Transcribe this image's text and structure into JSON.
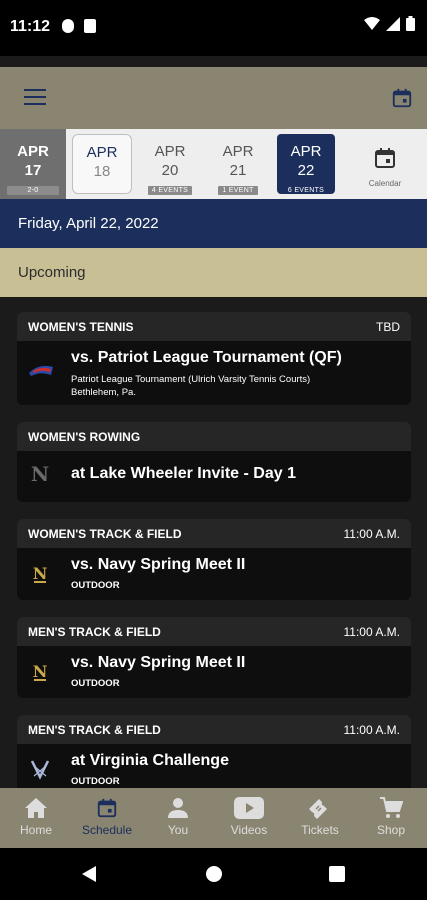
{
  "status_bar": {
    "time": "11:12"
  },
  "dates": [
    {
      "month": "APR",
      "day": "17",
      "badge": "2-0"
    },
    {
      "month": "APR",
      "day": "18",
      "badge": ""
    },
    {
      "month": "APR",
      "day": "20",
      "badge": "4 EVENTS"
    },
    {
      "month": "APR",
      "day": "21",
      "badge": "1 EVENT"
    },
    {
      "month": "APR",
      "day": "22",
      "badge": "6 EVENTS"
    }
  ],
  "calendar_label": "Calendar",
  "date_header": "Friday, April 22, 2022",
  "section_label": "Upcoming",
  "events": [
    {
      "sport": "WOMEN'S TENNIS",
      "time": "TBD",
      "title": "vs. Patriot League Tournament (QF)",
      "sub1": "Patriot League Tournament (Ulrich Varsity Tennis Courts)",
      "sub2": "Bethlehem, Pa."
    },
    {
      "sport": "WOMEN'S ROWING",
      "time": "",
      "title": "at Lake Wheeler Invite - Day 1",
      "sub1": "",
      "sub2": ""
    },
    {
      "sport": "WOMEN'S TRACK & FIELD",
      "time": "11:00 A.M.",
      "title": "vs. Navy Spring Meet II",
      "sub1": "OUTDOOR",
      "sub2": ""
    },
    {
      "sport": "MEN'S TRACK & FIELD",
      "time": "11:00 A.M.",
      "title": "vs. Navy Spring Meet II",
      "sub1": "OUTDOOR",
      "sub2": ""
    },
    {
      "sport": "MEN'S TRACK & FIELD",
      "time": "11:00 A.M.",
      "title": "at Virginia Challenge",
      "sub1": "OUTDOOR",
      "sub2": ""
    }
  ],
  "nav": [
    {
      "label": "Home",
      "icon": "home-icon"
    },
    {
      "label": "Schedule",
      "icon": "calendar-icon"
    },
    {
      "label": "You",
      "icon": "person-icon"
    },
    {
      "label": "Videos",
      "icon": "play-icon"
    },
    {
      "label": "Tickets",
      "icon": "ticket-icon"
    },
    {
      "label": "Shop",
      "icon": "cart-icon"
    }
  ],
  "colors": {
    "navy": "#1c2f5c",
    "gold_bar": "#8a8571",
    "tan": "#c9bf94"
  }
}
